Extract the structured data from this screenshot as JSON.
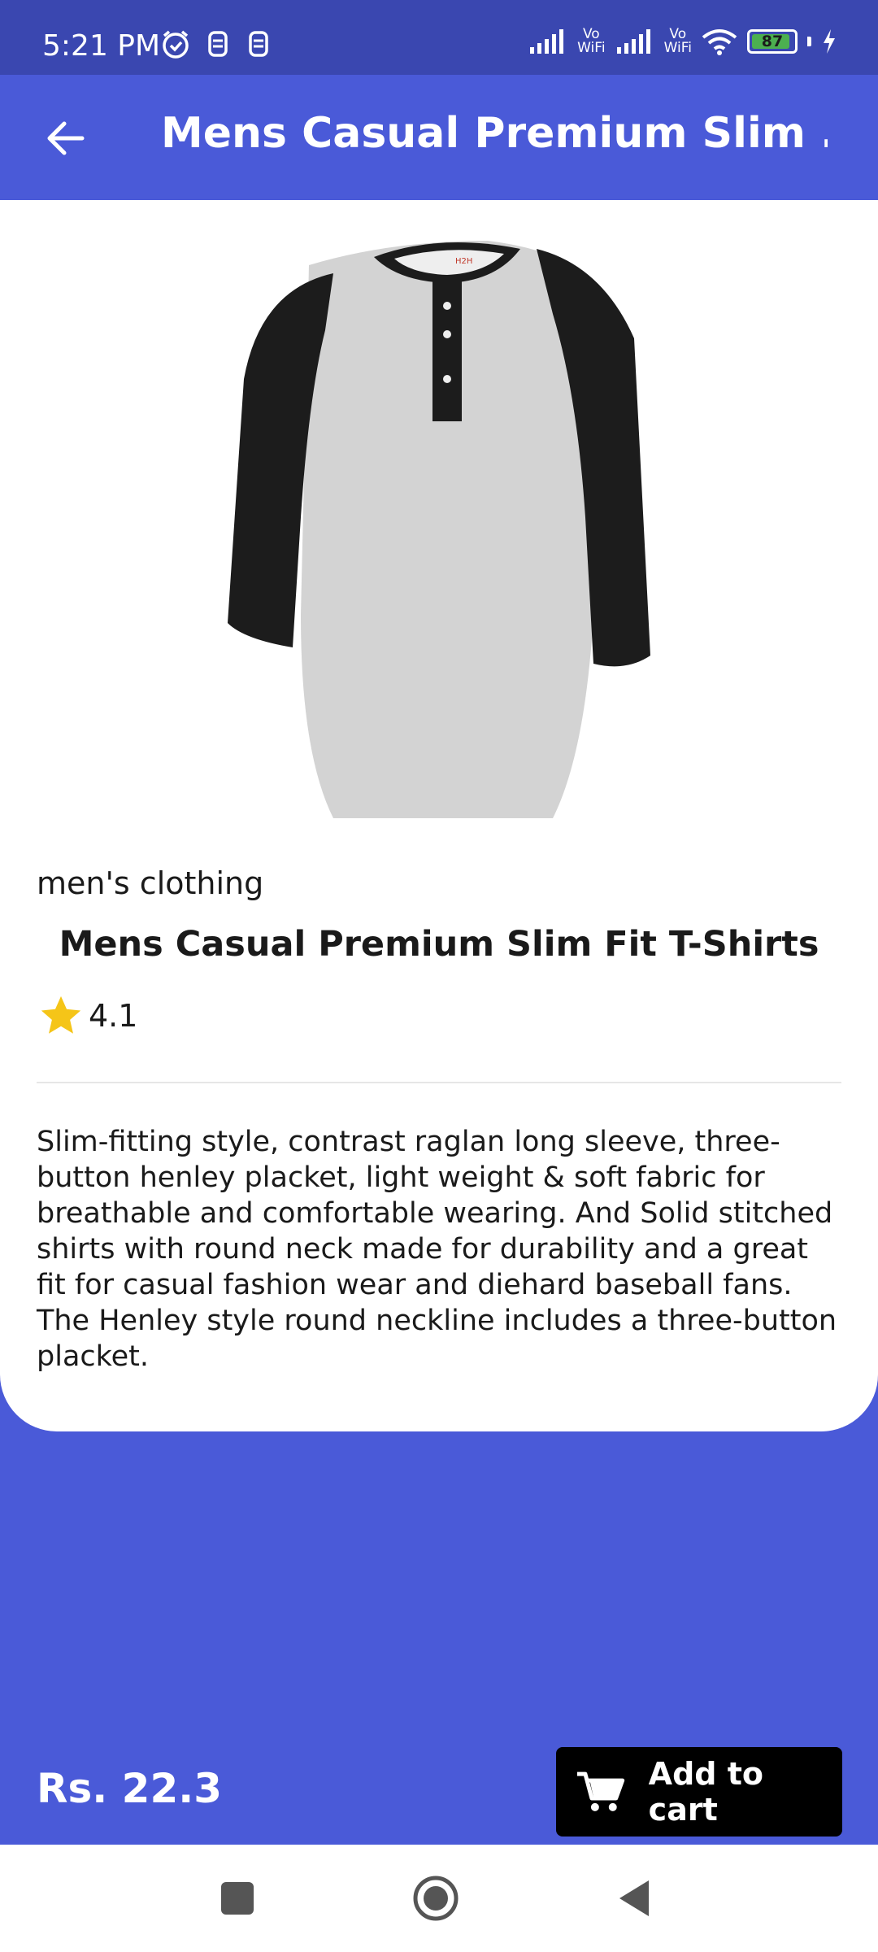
{
  "status_bar": {
    "time": "5:21 PM",
    "vowifi_1": "Vo\nWiFi",
    "vowifi_2": "Vo\nWiFi",
    "battery": "87"
  },
  "app_bar": {
    "title": "Mens Casual Premium Slim ..."
  },
  "product": {
    "category": "men's clothing",
    "title": "Mens Casual Premium Slim Fit T-Shirts",
    "rating": "4.1",
    "description": "Slim-fitting style, contrast raglan long sleeve, three-button henley placket, light weight & soft fabric for breathable and comfortable wearing. And Solid stitched shirts with round neck made for durability and a great fit for casual fashion wear and diehard baseball fans. The Henley style round neckline includes a three-button placket.",
    "image_label": "H2H"
  },
  "footer": {
    "price": "Rs. 22.3",
    "add_to_cart_label": "Add to cart"
  },
  "colors": {
    "primary": "#4a5ad8",
    "status_bar": "#3a47b0",
    "star": "#f5c518",
    "button": "#000000"
  }
}
